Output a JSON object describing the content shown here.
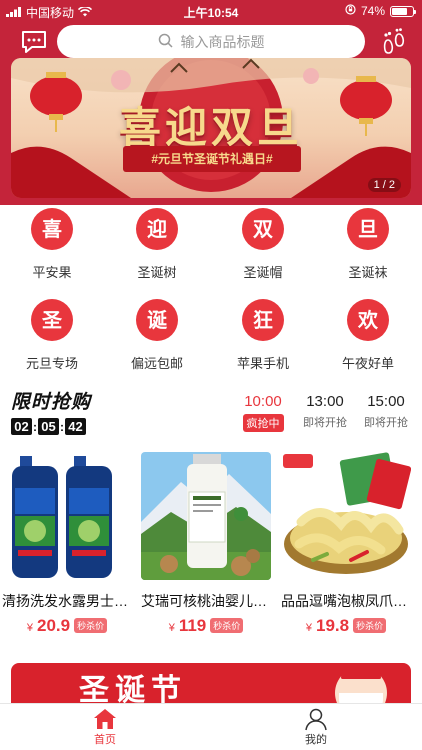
{
  "status_bar": {
    "carrier": "中国移动",
    "time": "上午10:54",
    "battery": "74%",
    "battery_level": 0.74
  },
  "header": {
    "message_icon": "chat-bubble-icon",
    "search_placeholder": "输入商品标题",
    "footprint_icon": "footprint-icon"
  },
  "banner": {
    "title": "喜迎双旦",
    "subtitle": "#元旦节圣诞节礼遇日#",
    "indicator": "1 / 2",
    "colors": {
      "primary": "#c4243a",
      "gold": "#f7d98c"
    }
  },
  "categories": [
    {
      "glyph": "喜",
      "label": "平安果"
    },
    {
      "glyph": "迎",
      "label": "圣诞树"
    },
    {
      "glyph": "双",
      "label": "圣诞帽"
    },
    {
      "glyph": "旦",
      "label": "圣诞袜"
    },
    {
      "glyph": "圣",
      "label": "元旦专场"
    },
    {
      "glyph": "诞",
      "label": "偏远包邮"
    },
    {
      "glyph": "狂",
      "label": "苹果手机"
    },
    {
      "glyph": "欢",
      "label": "午夜好单"
    }
  ],
  "flash_sale": {
    "title": "限时抢购",
    "countdown": {
      "h": "02",
      "m": "05",
      "s": "42"
    },
    "slots": [
      {
        "time": "10:00",
        "status": "疯抢中",
        "active": true
      },
      {
        "time": "13:00",
        "status": "即将开抢",
        "active": false
      },
      {
        "time": "15:00",
        "status": "即将开抢",
        "active": false
      }
    ]
  },
  "products": [
    {
      "name": "清扬洗发水露男士专用",
      "currency": "¥",
      "price": "20.9",
      "tag": "秒杀价"
    },
    {
      "name": "艾瑞可核桃油婴儿专用",
      "currency": "¥",
      "price": "119",
      "tag": "秒杀价"
    },
    {
      "name": "品品逗嘴泡椒凤爪零食",
      "currency": "¥",
      "price": "19.8",
      "tag": "秒杀价"
    }
  ],
  "promo": {
    "text": "圣诞节"
  },
  "tabbar": {
    "items": [
      {
        "label": "首页",
        "icon": "home-icon",
        "active": true
      },
      {
        "label": "我的",
        "icon": "person-icon",
        "active": false
      }
    ],
    "active_color": "#e8363d"
  }
}
